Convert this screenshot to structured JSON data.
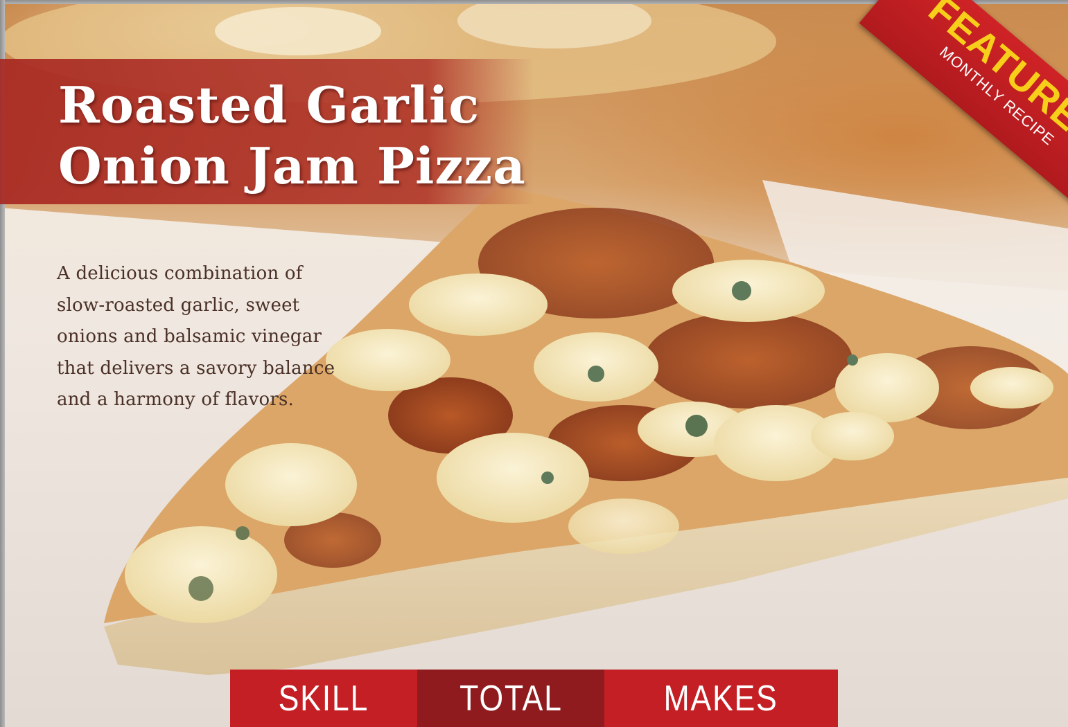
{
  "recipe": {
    "title_line1": "Roasted Garlic",
    "title_line2": "Onion Jam Pizza",
    "description": "A delicious combination of slow-roasted garlic, sweet onions and balsamic vinegar that delivers a savory balance and a harmony of flavors."
  },
  "badge": {
    "main": "FEATURED",
    "sub": "MONTHLY RECIPE"
  },
  "stats": {
    "skill_label": "SKILL",
    "total_label": "TOTAL",
    "makes_label": "MAKES"
  },
  "colors": {
    "accent_red": "#c41f24",
    "dark_red": "#8f1b1e",
    "badge_yellow": "#f7cf1a",
    "text_brown": "#4a3026"
  }
}
